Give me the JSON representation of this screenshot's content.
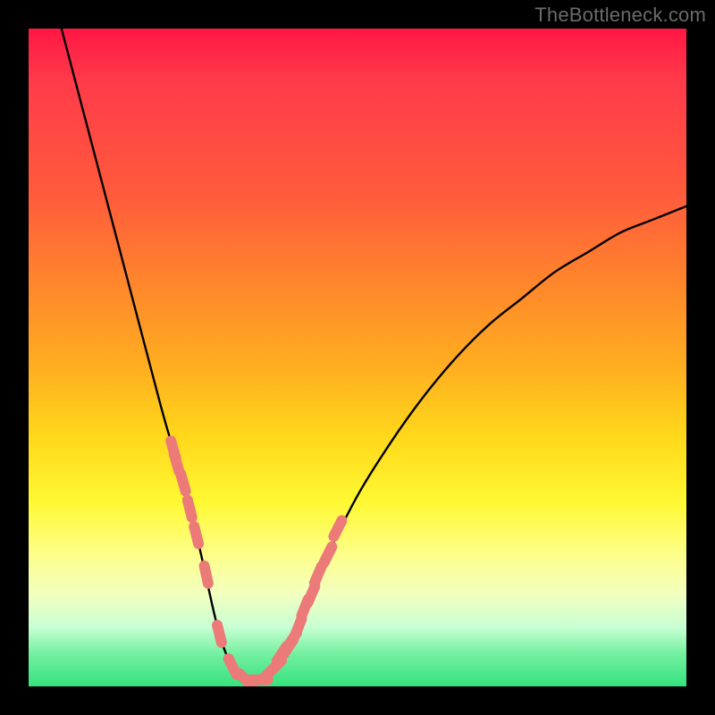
{
  "watermark": "TheBottleneck.com",
  "colors": {
    "curve": "#000000",
    "marker": "#eb7a79",
    "background_top": "#ff1744",
    "background_bottom": "#35e27e",
    "frame": "#000000"
  },
  "chart_data": {
    "type": "line",
    "title": "",
    "xlabel": "",
    "ylabel": "",
    "xlim": [
      0,
      100
    ],
    "ylim": [
      0,
      100
    ],
    "grid": false,
    "legend": false,
    "series": [
      {
        "name": "bottleneck-curve",
        "x": [
          5,
          10,
          15,
          20,
          22,
          24,
          26,
          28,
          29,
          30,
          31,
          32,
          33,
          34,
          35,
          36,
          37,
          38,
          40,
          42,
          45,
          50,
          55,
          60,
          65,
          70,
          75,
          80,
          85,
          90,
          95,
          100
        ],
        "y": [
          100,
          81,
          62,
          43,
          36,
          29,
          21,
          12,
          8,
          5,
          3,
          2,
          1,
          1,
          1,
          2,
          3,
          4,
          7,
          12,
          19,
          29,
          37,
          44,
          50,
          55,
          59,
          63,
          66,
          69,
          71,
          73
        ]
      }
    ],
    "markers": {
      "name": "highlighted-points",
      "x": [
        22.0,
        22.5,
        23.5,
        24.5,
        25.5,
        27.0,
        29.0,
        31.0,
        33.0,
        35.0,
        36.5,
        37.5,
        38.5,
        39.5,
        40.0,
        41.0,
        42.0,
        43.0,
        44.0,
        45.5,
        47.0
      ],
      "y": [
        36,
        34,
        31,
        27,
        23,
        17,
        8,
        3,
        1,
        1,
        2,
        3,
        5,
        6,
        7,
        9,
        12,
        14,
        17,
        20,
        24
      ]
    }
  }
}
